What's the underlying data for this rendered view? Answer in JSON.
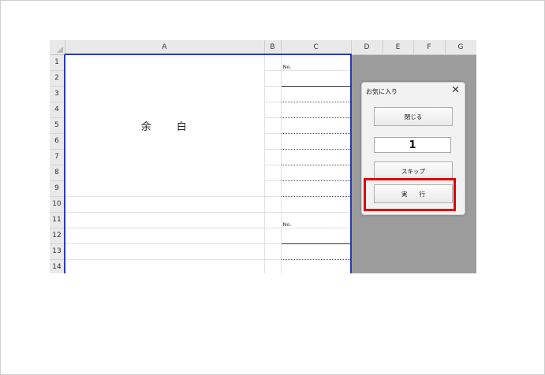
{
  "sheet": {
    "columns": [
      "A",
      "B",
      "C",
      "D",
      "E",
      "F",
      "G"
    ],
    "rows": [
      "1",
      "2",
      "3",
      "4",
      "5",
      "6",
      "7",
      "8",
      "9",
      "10",
      "11",
      "12",
      "13",
      "14"
    ],
    "merged_text": "余　　白",
    "no_label_1": "No.",
    "no_label_2": "No."
  },
  "dialog": {
    "title": "お気に入り",
    "close_symbol": "✕",
    "close_button_label": "閉じる",
    "number_value": "1",
    "skip_button_label": "スキップ",
    "run_button_label": "実　　行"
  },
  "colors": {
    "highlight": "#e00000",
    "print_border": "#2a3bb5",
    "gray_area": "#9c9c9c"
  }
}
